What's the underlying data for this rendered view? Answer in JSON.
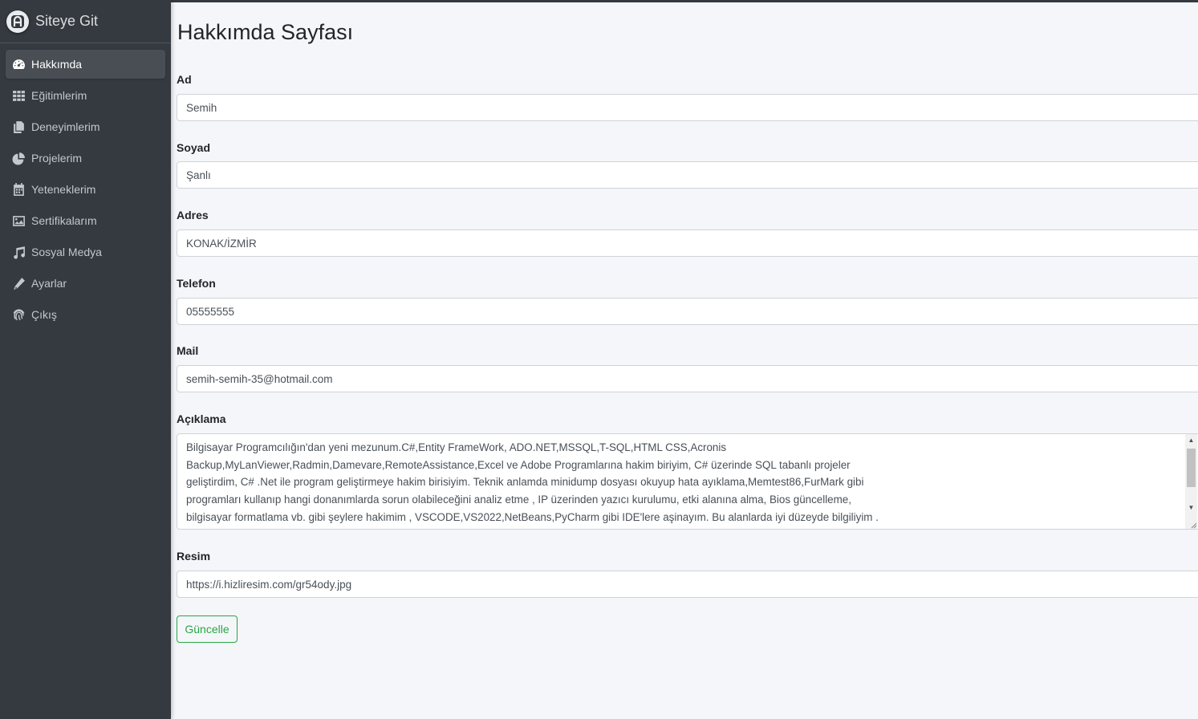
{
  "brand": {
    "text": "Siteye Git"
  },
  "sidebar": {
    "items": [
      {
        "label": "Hakkımda",
        "icon": "dashboard-gauge-icon",
        "active": true
      },
      {
        "label": "Eğitimlerim",
        "icon": "grid-table-icon",
        "active": false
      },
      {
        "label": "Deneyimlerim",
        "icon": "copy-documents-icon",
        "active": false
      },
      {
        "label": "Projelerim",
        "icon": "pie-chart-icon",
        "active": false
      },
      {
        "label": "Yeteneklerim",
        "icon": "calendar-icon",
        "active": false
      },
      {
        "label": "Sertifikalarım",
        "icon": "image-icon",
        "active": false
      },
      {
        "label": "Sosyal Medya",
        "icon": "music-note-icon",
        "active": false
      },
      {
        "label": "Ayarlar",
        "icon": "pencil-icon",
        "active": false
      },
      {
        "label": "Çıkış",
        "icon": "fingerprint-icon",
        "active": false
      }
    ]
  },
  "page": {
    "title": "Hakkımda Sayfası"
  },
  "form": {
    "ad": {
      "label": "Ad",
      "value": "Semih"
    },
    "soyad": {
      "label": "Soyad",
      "value": "Şanlı"
    },
    "adres": {
      "label": "Adres",
      "value": "KONAK/İZMİR"
    },
    "telefon": {
      "label": "Telefon",
      "value": "05555555"
    },
    "mail": {
      "label": "Mail",
      "value": "semih-semih-35@hotmail.com"
    },
    "aciklama": {
      "label": "Açıklama",
      "lines": [
        "Bilgisayar Programcılığın'dan yeni mezunum.C#,Entity FrameWork, ADO.NET,MSSQL,T-SQL,HTML CSS,Acronis",
        "Backup,MyLanViewer,Radmin,Damevare,RemoteAssistance,Excel ve Adobe Programlarına hakim biriyim, C# üzerinde SQL tabanlı projeler",
        "geliştirdim, C# .Net ile program geliştirmeye hakim birisiyim. Teknik anlamda minidump dosyası okuyup hata ayıklama,Memtest86,FurMark gibi",
        "programları kullanıp hangi donanımlarda sorun olabileceğini analiz etme , IP üzerinden yazıcı kurulumu, etki alanına alma, Bios güncelleme,",
        "bilgisayar formatlama vb. gibi şeylere hakimim , VSCODE,VS2022,NetBeans,PyCharm gibi IDE'lere aşinayım. Bu alanlarda iyi düzeyde bilgiliyim ."
      ]
    },
    "resim": {
      "label": "Resim",
      "value": "https://i.hizliresim.com/gr54ody.jpg"
    },
    "submit_label": "Güncelle"
  },
  "colors": {
    "sidebar_bg": "#343a40",
    "content_bg": "#f4f6f9",
    "button_outline": "#28a745"
  }
}
